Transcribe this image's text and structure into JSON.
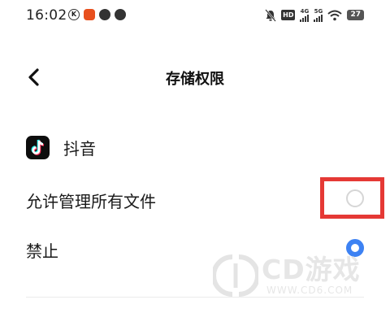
{
  "status_bar": {
    "time": "16:02",
    "network_1": "4G",
    "network_2": "5G",
    "hd": "HD",
    "battery": "27"
  },
  "header": {
    "title": "存储权限"
  },
  "app": {
    "name": "抖音"
  },
  "options": [
    {
      "label": "允许管理所有文件",
      "selected": false
    },
    {
      "label": "禁止",
      "selected": true
    }
  ],
  "watermark": {
    "brand": "CD游戏",
    "url": "WWW.CD6.COM"
  },
  "colors": {
    "accent": "#3d82f3",
    "highlight": "#e53935"
  }
}
